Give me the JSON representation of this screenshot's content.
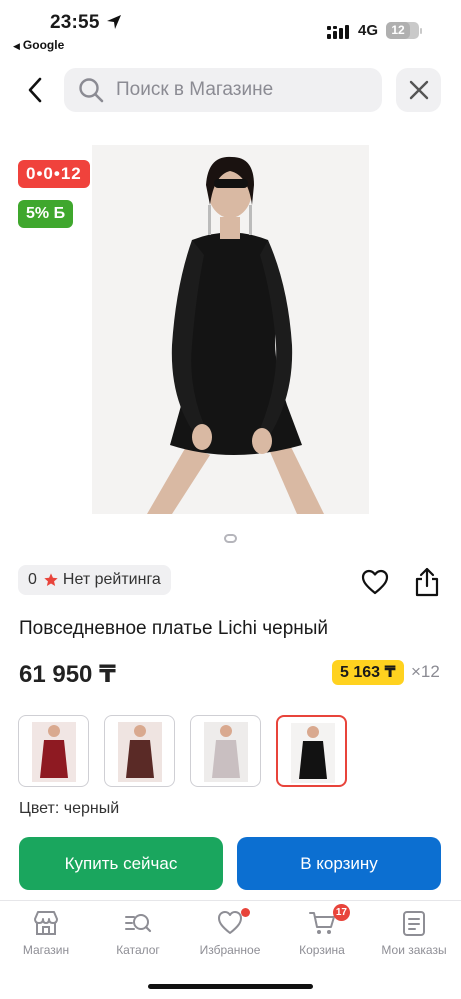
{
  "status_bar": {
    "time": "23:55",
    "back_app": "Google",
    "network": "4G",
    "battery": "12"
  },
  "search": {
    "placeholder": "Поиск в Магазине"
  },
  "product": {
    "installment_badge": "0•0•12",
    "bonus_badge": "5% Б",
    "rating_count": "0",
    "rating_text": "Нет рейтинга",
    "title": "Повседневное платье Lichi черный",
    "price": "61 950 ₸",
    "installment_price": "5 163 ₸",
    "installment_months": "×12",
    "color_label": "Цвет: черный"
  },
  "variants": [
    {
      "name": "red-dress",
      "color": "#8e1a22",
      "selected": false
    },
    {
      "name": "burgundy-dress",
      "color": "#5a2a26",
      "selected": false
    },
    {
      "name": "silver-dress",
      "color": "#c9bfc1",
      "selected": false
    },
    {
      "name": "black-dress",
      "color": "#121212",
      "selected": true
    }
  ],
  "actions": {
    "buy_now": "Купить сейчас",
    "add_to_cart": "В корзину"
  },
  "tabbar": {
    "items": [
      {
        "label": "Магазин",
        "icon": "store-icon"
      },
      {
        "label": "Каталог",
        "icon": "catalog-search-icon"
      },
      {
        "label": "Избранное",
        "icon": "heart-icon"
      },
      {
        "label": "Корзина",
        "icon": "cart-icon",
        "badge": "17"
      },
      {
        "label": "Мои заказы",
        "icon": "orders-icon"
      }
    ]
  },
  "colors": {
    "installment_red": "#f0423c",
    "bonus_green": "#3fa72d",
    "buy_green": "#1aa65e",
    "cart_blue": "#0c6fd1",
    "installment_yellow": "#ffd21f"
  }
}
